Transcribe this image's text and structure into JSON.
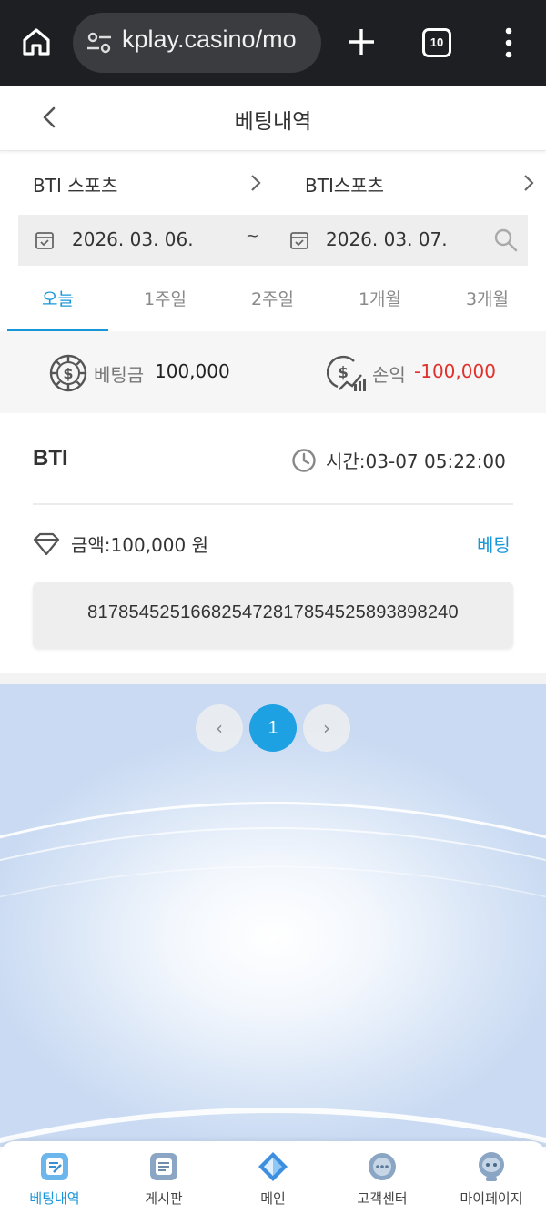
{
  "browser": {
    "url": "kplay.casino/mo",
    "tab_count": "10"
  },
  "header": {
    "title": "베팅내역"
  },
  "selectors": {
    "left": "BTI 스포츠",
    "right": "BTI스포츠"
  },
  "date_range": {
    "from": "2026. 03. 06.",
    "separator": "~",
    "to": "2026. 03. 07."
  },
  "period_tabs": [
    {
      "label": "오늘",
      "active": true
    },
    {
      "label": "1주일",
      "active": false
    },
    {
      "label": "2주일",
      "active": false
    },
    {
      "label": "1개월",
      "active": false
    },
    {
      "label": "3개월",
      "active": false
    }
  ],
  "summary": {
    "bet_label": "베팅금",
    "bet_value": "100,000",
    "profit_label": "손익",
    "profit_value": "-100,000"
  },
  "bet": {
    "provider": "BTI",
    "time": "시간:03-07 05:22:00",
    "amount": "금액:100,000 원",
    "status": "베팅",
    "bet_id": "81785452516682547281785452589389824​0"
  },
  "pagination": {
    "prev": "‹",
    "current": "1",
    "next": "›"
  },
  "bottom_nav": [
    {
      "label": "베팅내역",
      "icon": "bet-history-icon",
      "active": true
    },
    {
      "label": "게시판",
      "icon": "board-icon",
      "active": false
    },
    {
      "label": "메인",
      "icon": "main-diamond-icon",
      "active": false
    },
    {
      "label": "고객센터",
      "icon": "chat-icon",
      "active": false
    },
    {
      "label": "마이페이지",
      "icon": "user-face-icon",
      "active": false
    }
  ],
  "colors": {
    "accent": "#1796d8",
    "negative": "#e0322d",
    "browser_bg": "#1e1f22"
  }
}
